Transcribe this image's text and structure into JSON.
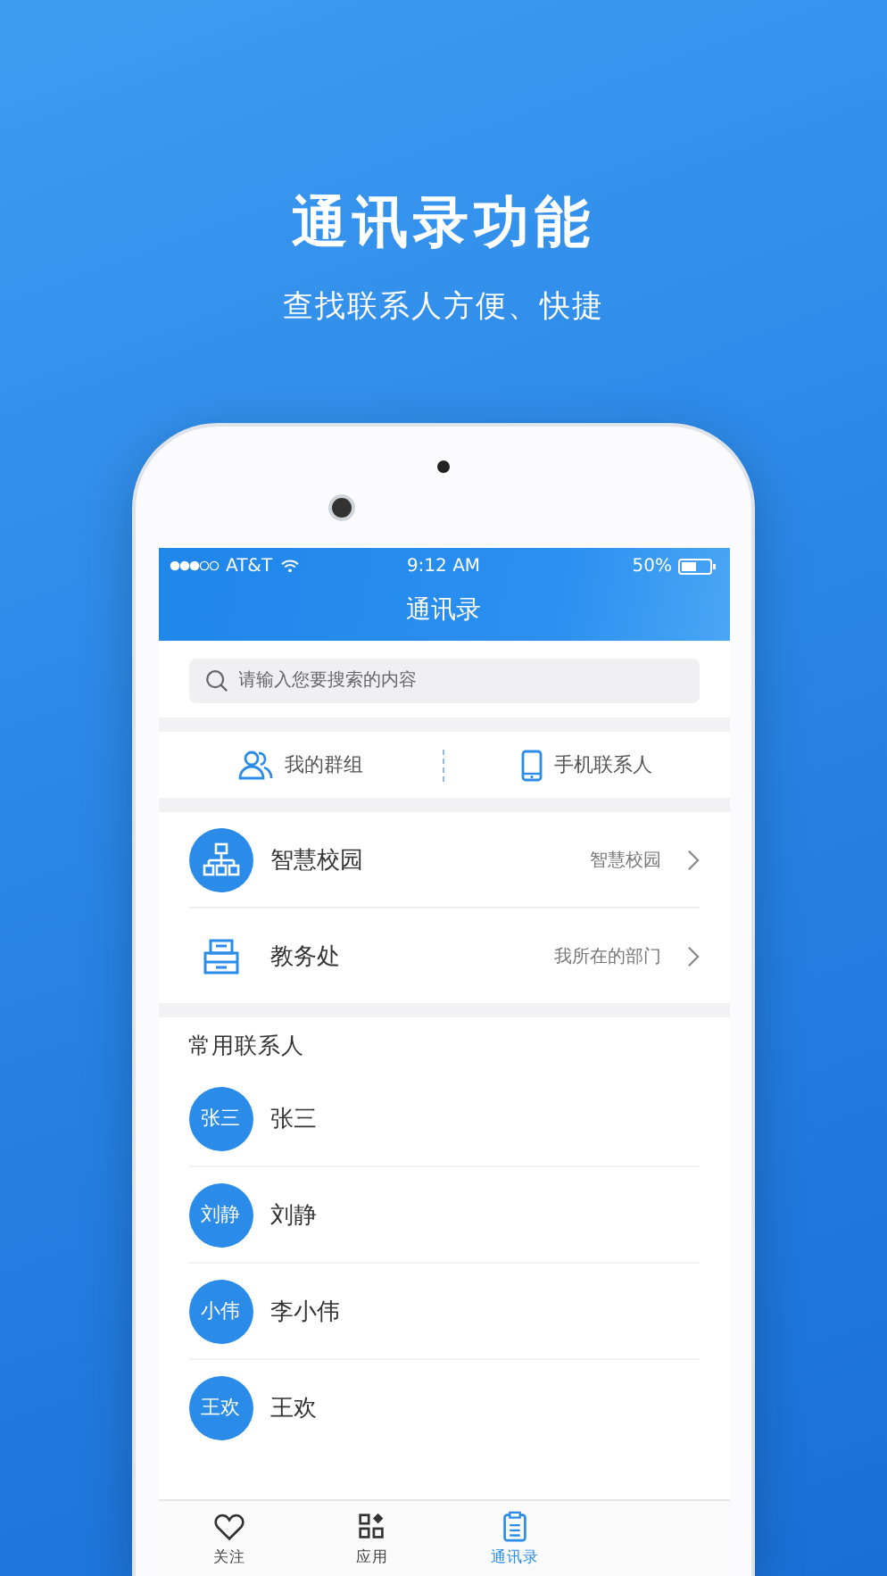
{
  "headline": "通讯录功能",
  "subtitle": "查找联系人方便、快捷",
  "status_bar": {
    "carrier": "AT&T",
    "time": "9:12 AM",
    "battery": "50%"
  },
  "nav_title": "通讯录",
  "search": {
    "placeholder": "请输入您要搜索的内容"
  },
  "segments": [
    {
      "label": "我的群组"
    },
    {
      "label": "手机联系人"
    }
  ],
  "entries": [
    {
      "title": "智慧校园",
      "detail": "智慧校园"
    },
    {
      "title": "教务处",
      "detail": "我所在的部门"
    }
  ],
  "section_title": "常用联系人",
  "contacts": [
    {
      "avatar": "张三",
      "name": "张三"
    },
    {
      "avatar": "刘静",
      "name": "刘静"
    },
    {
      "avatar": "小伟",
      "name": "李小伟"
    },
    {
      "avatar": "王欢",
      "name": "王欢"
    }
  ],
  "tab_bar": [
    {
      "label": "关注",
      "selected": false
    },
    {
      "label": "应用",
      "selected": false
    },
    {
      "label": "通讯录",
      "selected": true
    }
  ]
}
